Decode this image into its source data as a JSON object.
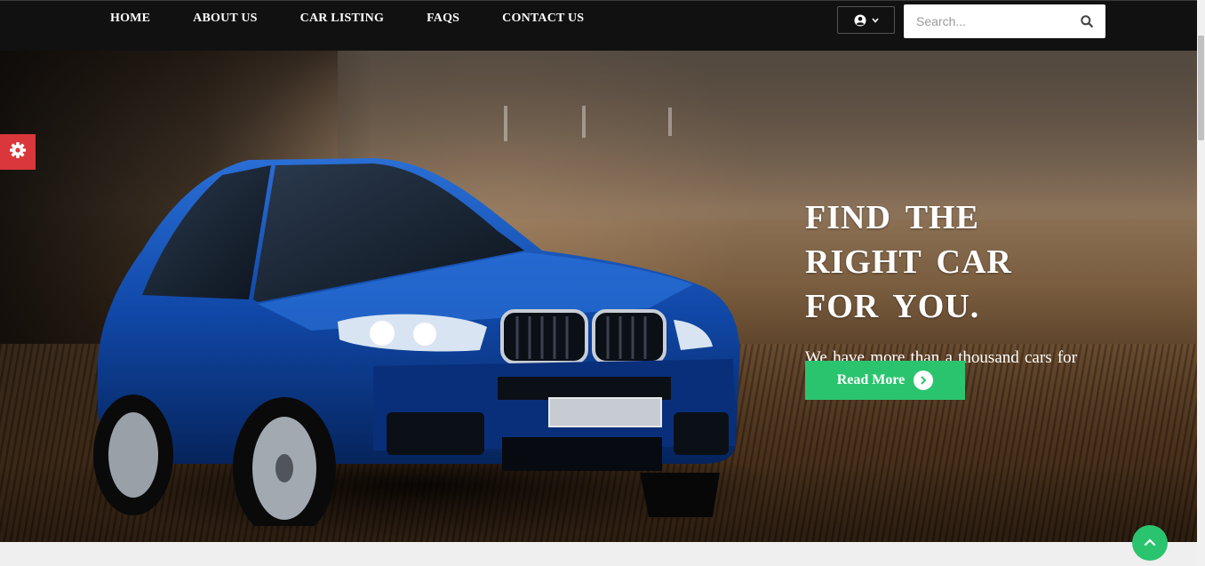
{
  "nav": {
    "items": [
      {
        "label": "HOME"
      },
      {
        "label": "ABOUT US"
      },
      {
        "label": "CAR LISTING"
      },
      {
        "label": "FAQS"
      },
      {
        "label": "CONTACT US"
      }
    ],
    "user_icon": "user-circle-icon",
    "caret_icon": "chevron-down-icon"
  },
  "search": {
    "placeholder": "Search...",
    "value": "",
    "icon": "search-icon"
  },
  "hero": {
    "title": "FIND THE RIGHT CAR FOR YOU.",
    "subtitle": "We have more than a thousand cars for you to choose.",
    "button_label": "Read More",
    "button_icon": "chevron-right-circle-icon"
  },
  "settings": {
    "icon": "gear-icon"
  },
  "back_to_top": {
    "icon": "chevron-up-icon"
  },
  "colors": {
    "nav_bg": "#111111",
    "accent_green": "#2bc46e",
    "settings_red": "#d9373b",
    "page_bg": "#efefef"
  }
}
